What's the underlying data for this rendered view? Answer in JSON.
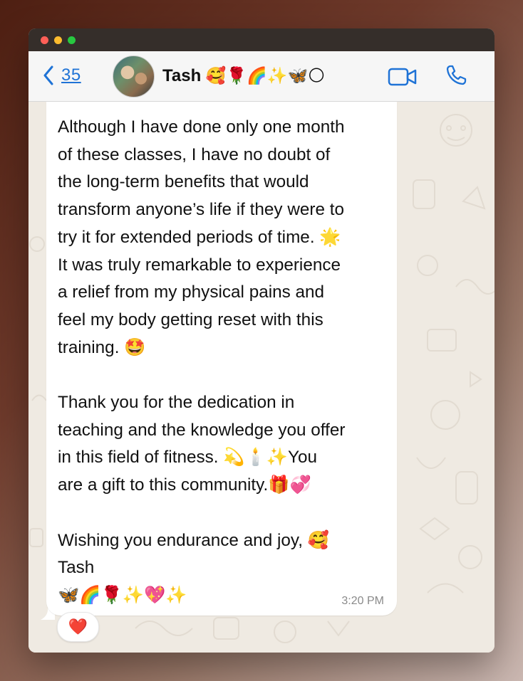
{
  "window": {
    "traffic_lights": [
      "close",
      "minimize",
      "zoom"
    ]
  },
  "header": {
    "back_count": "35",
    "contact_name": "Tash",
    "contact_emojis": "🥰🌹🌈✨🦋🌕",
    "icons": [
      "chevron-left-icon",
      "video-camera-icon",
      "phone-icon"
    ]
  },
  "message": {
    "text": "Although I have done only one month\nof these classes, I have no doubt of\nthe long-term benefits that would\ntransform anyone’s life if they were to\ntry it for extended periods of time. 🌟\nIt was truly remarkable to experience\na relief from my physical pains and\nfeel my body getting reset with this\ntraining. 🤩\n\nThank you for the dedication in\nteaching and the knowledge you offer\nin this field of fitness. 💫🕯️✨You\nare a gift to this community.🎁💞\n\nWishing you endurance and joy, 🥰\nTash\n🦋🌈🌹✨💖✨",
    "time": "3:20 PM",
    "reaction": "❤️"
  },
  "colors": {
    "accent": "#1f73d6",
    "chat_background": "#efeae2",
    "bubble": "#ffffff",
    "header": "#f6f6f6"
  }
}
